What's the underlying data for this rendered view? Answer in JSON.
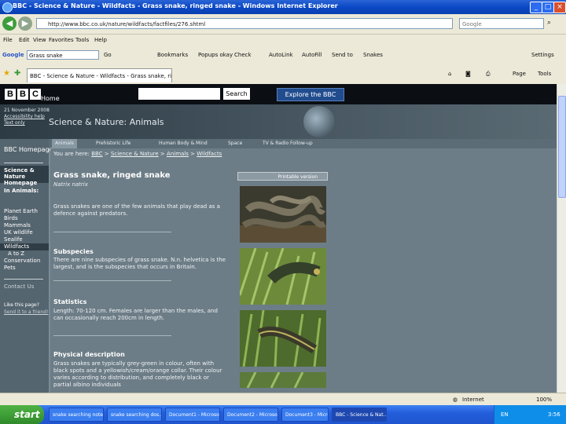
{
  "window": {
    "title": "BBC - Science & Nature - Wildfacts - Grass snake, ringed snake - Windows Internet Explorer",
    "min": "_",
    "max": "□",
    "close": "×"
  },
  "addressbar": {
    "url": "http://www.bbc.co.uk/nature/wildfacts/factfiles/276.shtml",
    "search_placeholder": "Google"
  },
  "menu": [
    "File",
    "Edit",
    "View",
    "Favorites",
    "Tools",
    "Help"
  ],
  "google_toolbar": {
    "label": "Google",
    "query": "Grass snake",
    "items": [
      "Go",
      "Bookmarks",
      "Popups okay",
      "Check",
      "AutoLink",
      "AutoFill",
      "Send to",
      "Snakes",
      "Settings"
    ]
  },
  "tab": {
    "label": "BBC - Science & Nature - Wildfacts - Grass snake, ring..."
  },
  "command_bar": [
    "Page",
    "Tools"
  ],
  "bbc": {
    "logo": [
      "B",
      "B",
      "C"
    ],
    "home": "Home",
    "search_button": "Search",
    "explore": "Explore the BBC",
    "date": "21 November 2008",
    "accessibility": "Accessibility help",
    "text_only": "Text only",
    "section_title": "Science & Nature: Animals"
  },
  "nav_tabs": [
    "Animals",
    "Prehistoric Life",
    "Human Body & Mind",
    "Space",
    "TV & Radio Follow-up"
  ],
  "left_nav": {
    "bbc_homepage": "BBC Homepage",
    "science_nature": "Science & Nature Homepage",
    "in_animals": "In Animals:",
    "items": [
      "Planet Earth",
      "Birds",
      "Mammals",
      "UK wildlife",
      "Sealife",
      "Wildfacts",
      "A to Z",
      "Conservation",
      "Pets"
    ],
    "contact": "Contact Us",
    "like_q": "Like this page?",
    "send": "Send it to a friend!"
  },
  "breadcrumb": {
    "prefix": "You are here:",
    "items": [
      "BBC",
      "Science & Nature",
      "Animals",
      "Wildfacts"
    ],
    "sep": " > "
  },
  "article": {
    "title": "Grass snake, ringed snake",
    "latin": "Natrix natrix",
    "intro": "Grass snakes are one of the few animals that play dead as a defence against predators.",
    "sections": [
      {
        "heading": "Subspecies",
        "text": "There are nine subspecies of grass snake. N.n. helvetica is the largest, and is the subspecies that occurs in Britain."
      },
      {
        "heading": "Statistics",
        "text": "Length: 70-120 cm. Females are larger than the males, and can occasionally reach 200cm in length."
      },
      {
        "heading": "Physical description",
        "text": "Grass snakes are typically grey-green in colour, often with black spots and a yellowish/cream/orange collar. Their colour varies according to distribution, and completely black or partial albino individuals"
      }
    ],
    "printable": "Printable version"
  },
  "status": {
    "zone": "Internet",
    "zoom": "100%"
  },
  "taskbar": {
    "start": "start",
    "tasks": [
      "snake searching notes",
      "snake searching dos...",
      "Document1 - Microsoft...",
      "Document2 - Microsoft...",
      "Document3 - Microsoft...",
      "BBC - Science & Nat..."
    ],
    "lang": "EN",
    "time": "3:56"
  }
}
